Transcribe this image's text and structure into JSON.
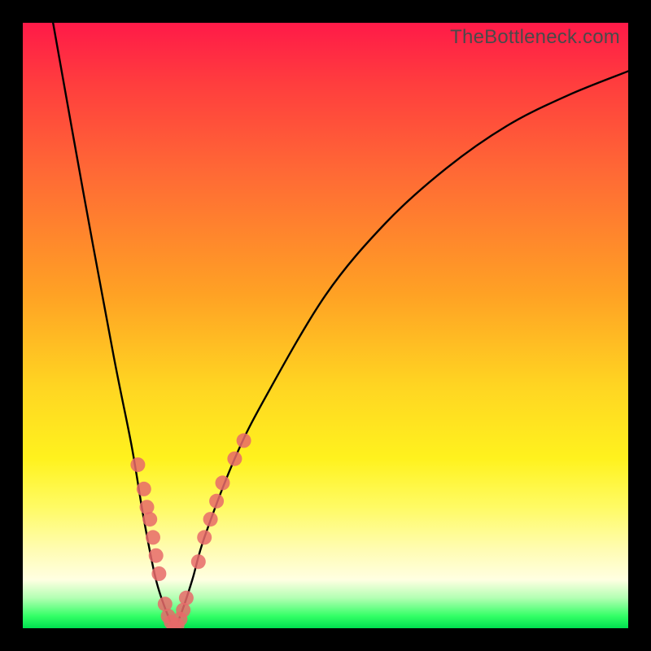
{
  "watermark": "TheBottleneck.com",
  "chart_data": {
    "type": "line",
    "title": "",
    "xlabel": "",
    "ylabel": "",
    "xlim": [
      0,
      100
    ],
    "ylim": [
      0,
      100
    ],
    "grid": false,
    "legend": false,
    "series": [
      {
        "name": "bottleneck-curve",
        "x": [
          5,
          10,
          15,
          18,
          20,
          22,
          24,
          25,
          26,
          28,
          30,
          35,
          40,
          50,
          60,
          70,
          80,
          90,
          100
        ],
        "y": [
          100,
          72,
          45,
          30,
          18,
          8,
          2,
          0,
          2,
          8,
          15,
          28,
          38,
          55,
          67,
          76,
          83,
          88,
          92
        ]
      }
    ],
    "markers": [
      {
        "name": "left-cluster",
        "x": [
          19,
          20,
          21,
          22,
          20.5,
          21.5,
          22.5
        ],
        "y": [
          27,
          23,
          18,
          12,
          20,
          15,
          9
        ]
      },
      {
        "name": "bottom-cluster",
        "x": [
          23.5,
          24,
          24.5,
          25,
          25.5,
          26,
          26.5,
          27
        ],
        "y": [
          4,
          2,
          1,
          0,
          0.5,
          1.5,
          3,
          5
        ]
      },
      {
        "name": "right-cluster",
        "x": [
          29,
          30,
          31,
          32,
          33,
          35,
          36.5
        ],
        "y": [
          11,
          15,
          18,
          21,
          24,
          28,
          31
        ]
      }
    ],
    "colors": {
      "curve": "#000000",
      "markers": "#e86a6a",
      "gradient_top": "#ff1a48",
      "gradient_mid": "#ffd522",
      "gradient_bottom": "#00e050"
    }
  }
}
